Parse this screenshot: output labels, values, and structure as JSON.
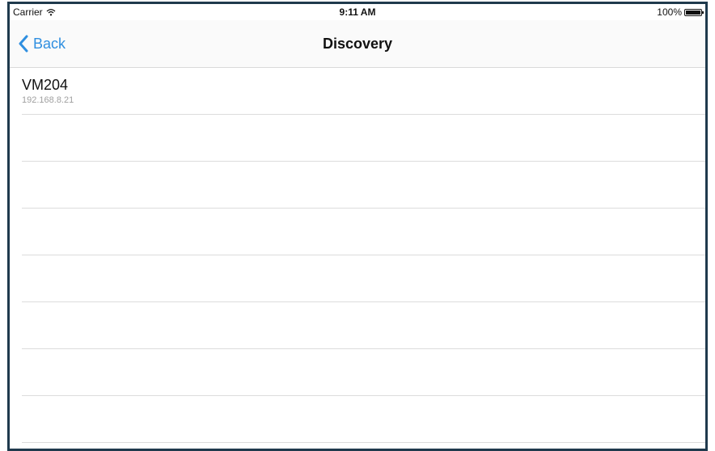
{
  "status_bar": {
    "carrier": "Carrier",
    "wifi_icon": "wifi-icon",
    "time": "9:11 AM",
    "battery_text": "100%",
    "battery_icon": "battery-icon",
    "battery_level": 1.0
  },
  "nav": {
    "back_label": "Back",
    "back_icon": "chevron-left-icon",
    "title": "Discovery",
    "accent_color": "#2f8fe0"
  },
  "devices": [
    {
      "name": "VM204",
      "ip": "192.168.8.21"
    }
  ]
}
